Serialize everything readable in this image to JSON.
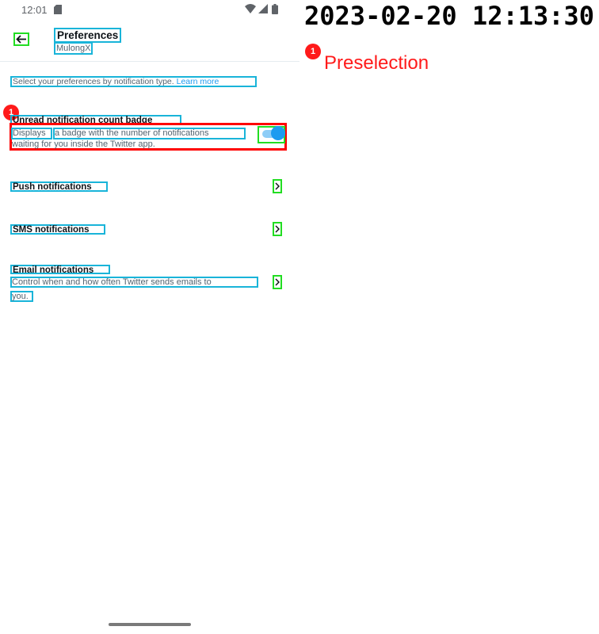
{
  "status_bar": {
    "time": "12:01",
    "icons": [
      "sd-card-icon",
      "wifi-icon",
      "signal-icon",
      "battery-icon"
    ]
  },
  "header": {
    "back_icon": "arrow-left-icon",
    "title": "Preferences",
    "subtitle": "MulongX"
  },
  "intro": {
    "text": "Select your preferences by notification type. ",
    "learn_more": "Learn more"
  },
  "settings": [
    {
      "title": "Unread notification count badge",
      "desc_line1_a": "Displays",
      "desc_line1_b": "a badge with the number of notifications",
      "desc_line2": "waiting for you inside the Twitter app.",
      "control": "toggle",
      "toggle_on": true
    },
    {
      "title": "Push notifications",
      "control": "chevron-right-icon"
    },
    {
      "title": "SMS notifications",
      "control": "chevron-right-icon"
    },
    {
      "title": "Email notifications",
      "desc_line1": "Control when and how often Twitter sends emails to",
      "desc_line2": "you.",
      "control": "chevron-right-icon"
    }
  ],
  "annotation": {
    "marker_number": "1",
    "legend_label": "Preselection",
    "timestamp": "2023-02-20 12:13:30.",
    "highlight_color": "#ff0000",
    "text_box_color": "#19b4d9",
    "interactive_box_color": "#22dd22"
  },
  "colors": {
    "accent": "#1d9bf0",
    "text_primary": "#0f1419",
    "text_secondary": "#536471"
  }
}
